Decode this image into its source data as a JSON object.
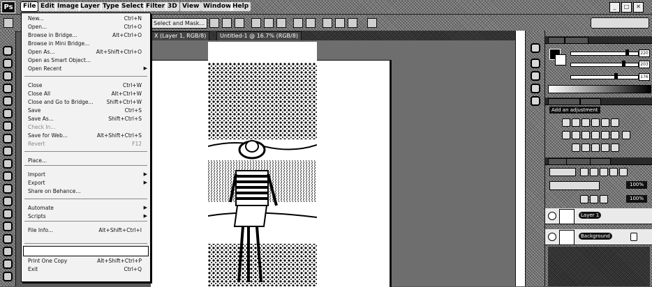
{
  "app": {
    "logo": "Ps"
  },
  "menubar": {
    "items": [
      "File",
      "Edit",
      "Image",
      "Layer",
      "Type",
      "Select",
      "Filter",
      "3D",
      "View",
      "Window",
      "Help"
    ]
  },
  "options_bar": {
    "mask_button": "Select and Mask..."
  },
  "tabs": [
    {
      "label": "X (Layer 1, RGB/8)"
    },
    {
      "label": "Untitled-1 @ 16.7% (RGB/8)"
    }
  ],
  "file_menu": {
    "items": [
      {
        "label": "New...",
        "shortcut": "Ctrl+N"
      },
      {
        "label": "Open...",
        "shortcut": "Ctrl+O"
      },
      {
        "label": "Browse in Bridge...",
        "shortcut": "Alt+Ctrl+O"
      },
      {
        "label": "Browse in Mini Bridge...",
        "shortcut": ""
      },
      {
        "label": "Open As...",
        "shortcut": "Alt+Shift+Ctrl+O"
      },
      {
        "label": "Open as Smart Object...",
        "shortcut": ""
      },
      {
        "label": "Open Recent",
        "shortcut": "",
        "submenu": true
      },
      {
        "label": "Close",
        "shortcut": "Ctrl+W"
      },
      {
        "label": "Close All",
        "shortcut": "Alt+Ctrl+W"
      },
      {
        "label": "Close and Go to Bridge...",
        "shortcut": "Shift+Ctrl+W"
      },
      {
        "label": "Save",
        "shortcut": "Ctrl+S"
      },
      {
        "label": "Save As...",
        "shortcut": "Shift+Ctrl+S"
      },
      {
        "label": "Check In...",
        "shortcut": "",
        "disabled": true
      },
      {
        "label": "Save for Web...",
        "shortcut": "Alt+Shift+Ctrl+S"
      },
      {
        "label": "Revert",
        "shortcut": "F12",
        "disabled": true
      },
      {
        "label": "Place...",
        "shortcut": ""
      },
      {
        "label": "Import",
        "shortcut": "",
        "submenu": true
      },
      {
        "label": "Export",
        "shortcut": "",
        "submenu": true
      },
      {
        "label": "Share on Behance...",
        "shortcut": ""
      },
      {
        "label": "Automate",
        "shortcut": "",
        "submenu": true
      },
      {
        "label": "Scripts",
        "shortcut": "",
        "submenu": true
      },
      {
        "label": "File Info...",
        "shortcut": "Alt+Shift+Ctrl+I"
      },
      {
        "label": "Print One Copy",
        "shortcut": "Alt+Shift+Ctrl+P"
      },
      {
        "label": "Exit",
        "shortcut": "Ctrl+Q"
      }
    ]
  },
  "color_panel": {
    "sliders": [
      {
        "value": "220",
        "level": 0.86
      },
      {
        "value": "203",
        "level": 0.8
      },
      {
        "value": "176",
        "level": 0.69
      }
    ]
  },
  "adjustments_panel": {
    "add_label": "Add an adjustment"
  },
  "layers_panel": {
    "opacity": "100%",
    "fill": "100%",
    "layers": [
      {
        "name": "Layer 1"
      },
      {
        "name": "Background"
      }
    ]
  }
}
